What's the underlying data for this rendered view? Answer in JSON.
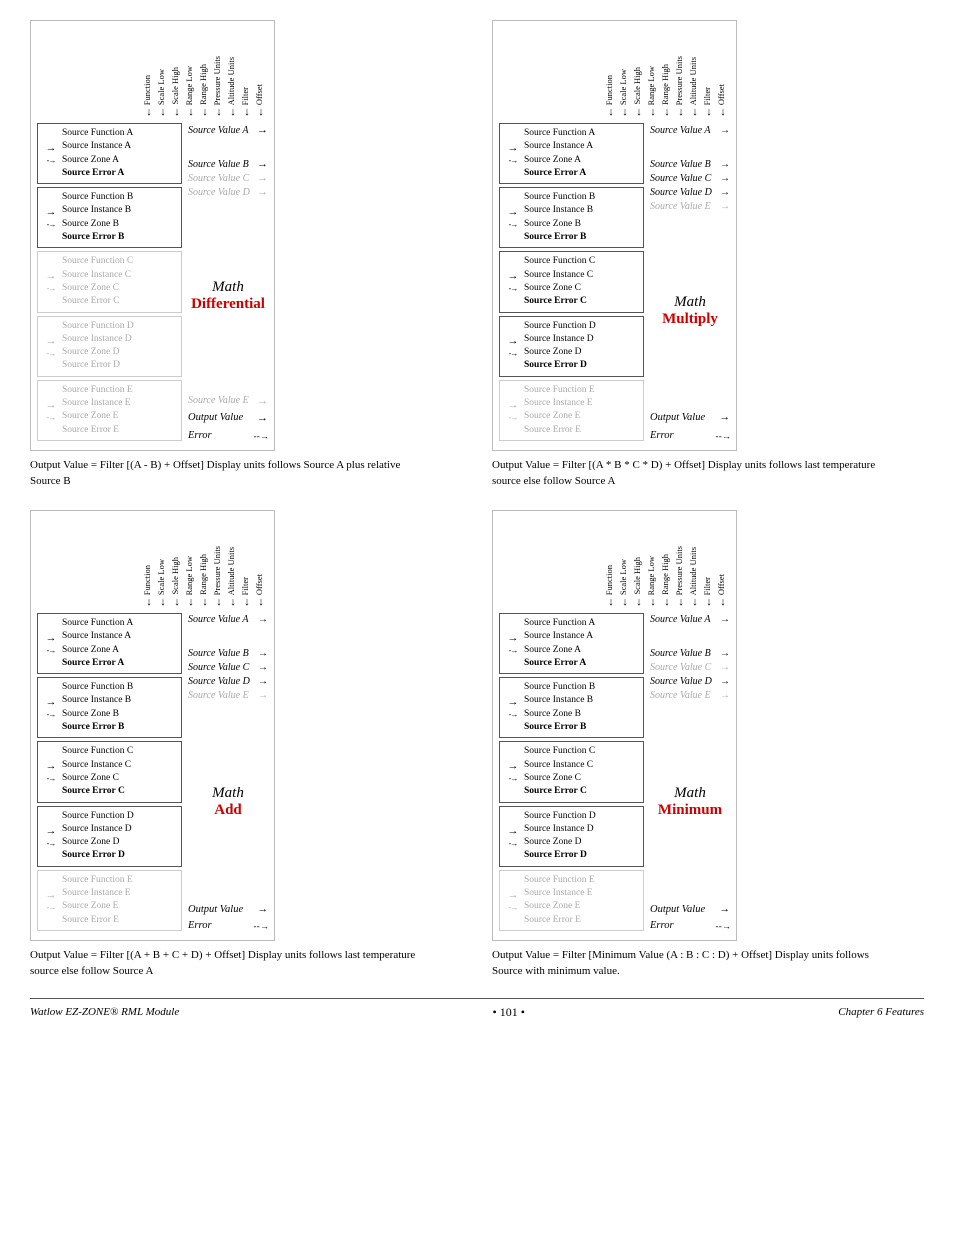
{
  "page": {
    "title": "Watlow EZ-ZONE® RML Module",
    "page_number": "101",
    "chapter": "Chapter 6 Features"
  },
  "col_headers": [
    "Function",
    "Scale Low",
    "Scale High",
    "Range Low",
    "Range High",
    "Pressure Units",
    "Altitude Units",
    "Filter",
    "Offset"
  ],
  "diagrams": [
    {
      "id": "diag1",
      "math_label": "Math",
      "math_type": "Differential",
      "math_color": "differential",
      "sources": [
        {
          "id": "A",
          "active": true,
          "function": "Source Function A",
          "instance": "Source Instance A",
          "zone": "Source Zone A",
          "error": "Source Error A",
          "has_solid_arrow": true,
          "has_dashed_arrow": true
        },
        {
          "id": "B",
          "active": true,
          "function": "Source Function B",
          "instance": "Source Instance B",
          "zone": "Source Zone B",
          "error": "Source Error B",
          "has_solid_arrow": true,
          "has_dashed_arrow": true
        },
        {
          "id": "C",
          "active": false,
          "function": "Source Function C",
          "instance": "Source Instance C",
          "zone": "Source Zone C",
          "error": "Source Error C",
          "has_solid_arrow": true,
          "has_dashed_arrow": true
        },
        {
          "id": "D",
          "active": false,
          "function": "Source Function D",
          "instance": "Source Instance D",
          "zone": "Source Zone D",
          "error": "Source Error D",
          "has_solid_arrow": true,
          "has_dashed_arrow": true
        },
        {
          "id": "E",
          "active": false,
          "function": "Source Function E",
          "instance": "Source Instance E",
          "zone": "Source Zone E",
          "error": "Source Error E",
          "has_solid_arrow": true,
          "has_dashed_arrow": true
        }
      ],
      "values": [
        {
          "label": "Source Value A",
          "active": true
        },
        {
          "label": "Source Value B",
          "active": true
        },
        {
          "label": "Source Value C",
          "active": false
        },
        {
          "label": "Source Value D",
          "active": false
        },
        {
          "label": "Source Value E",
          "active": false
        }
      ],
      "output_value": "Output Value",
      "output_error": "Error",
      "caption": "Output Value = Filter [(A - B) + Offset] Display units follows Source A plus relative Source B"
    },
    {
      "id": "diag2",
      "math_label": "Math",
      "math_type": "Multiply",
      "math_color": "multiply",
      "sources": [
        {
          "id": "A",
          "active": true,
          "function": "Source Function A",
          "instance": "Source Instance A",
          "zone": "Source Zone A",
          "error": "Source Error A"
        },
        {
          "id": "B",
          "active": true,
          "function": "Source Function B",
          "instance": "Source Instance B",
          "zone": "Source Zone B",
          "error": "Source Error B"
        },
        {
          "id": "C",
          "active": true,
          "function": "Source Function C",
          "instance": "Source Instance C",
          "zone": "Source Zone C",
          "error": "Source Error C"
        },
        {
          "id": "D",
          "active": true,
          "function": "Source Function D",
          "instance": "Source Instance D",
          "zone": "Source Zone D",
          "error": "Source Error D"
        },
        {
          "id": "E",
          "active": false,
          "function": "Source Function E",
          "instance": "Source Instance E",
          "zone": "Source Zone E",
          "error": "Source Error E"
        }
      ],
      "values": [
        {
          "label": "Source Value A",
          "active": true
        },
        {
          "label": "Source Value B",
          "active": true
        },
        {
          "label": "Source Value C",
          "active": true
        },
        {
          "label": "Source Value D",
          "active": true
        },
        {
          "label": "Source Value E",
          "active": false
        }
      ],
      "output_value": "Output Value",
      "output_error": "Error",
      "caption": "Output Value = Filter [(A * B * C * D) + Offset] Display units follows last temperature source else follow Source A"
    },
    {
      "id": "diag3",
      "math_label": "Math",
      "math_type": "Add",
      "math_color": "add",
      "sources": [
        {
          "id": "A",
          "active": true,
          "function": "Source Function A",
          "instance": "Source Instance A",
          "zone": "Source Zone A",
          "error": "Source Error A"
        },
        {
          "id": "B",
          "active": true,
          "function": "Source Function B",
          "instance": "Source Instance B",
          "zone": "Source Zone B",
          "error": "Source Error B"
        },
        {
          "id": "C",
          "active": true,
          "function": "Source Function C",
          "instance": "Source Instance C",
          "zone": "Source Zone C",
          "error": "Source Error C"
        },
        {
          "id": "D",
          "active": true,
          "function": "Source Function D",
          "instance": "Source Instance D",
          "zone": "Source Zone D",
          "error": "Source Error D"
        },
        {
          "id": "E",
          "active": false,
          "function": "Source Function E",
          "instance": "Source Instance E",
          "zone": "Source Zone E",
          "error": "Source Error E"
        }
      ],
      "values": [
        {
          "label": "Source Value A",
          "active": true
        },
        {
          "label": "Source Value B",
          "active": true
        },
        {
          "label": "Source Value C",
          "active": true
        },
        {
          "label": "Source Value D",
          "active": true
        },
        {
          "label": "Source Value E",
          "active": false
        }
      ],
      "output_value": "Output Value",
      "output_error": "Error",
      "caption": "Output Value = Filter [(A + B + C + D) + Offset] Display units follows last temperature source else follow Source A"
    },
    {
      "id": "diag4",
      "math_label": "Math",
      "math_type": "Minimum",
      "math_color": "minimum",
      "sources": [
        {
          "id": "A",
          "active": true,
          "function": "Source Function A",
          "instance": "Source Instance A",
          "zone": "Source Zone A",
          "error": "Source Error A"
        },
        {
          "id": "B",
          "active": true,
          "function": "Source Function B",
          "instance": "Source Instance B",
          "zone": "Source Zone B",
          "error": "Source Error B"
        },
        {
          "id": "C",
          "active": true,
          "function": "Source Function C",
          "instance": "Source Instance C",
          "zone": "Source Zone C",
          "error": "Source Error C"
        },
        {
          "id": "D",
          "active": true,
          "function": "Source Function D",
          "instance": "Source Instance D",
          "zone": "Source Zone D",
          "error": "Source Error D"
        },
        {
          "id": "E",
          "active": false,
          "function": "Source Function E",
          "instance": "Source Instance E",
          "zone": "Source Zone E",
          "error": "Source Error E"
        }
      ],
      "values": [
        {
          "label": "Source Value A",
          "active": true
        },
        {
          "label": "Source Value B",
          "active": true
        },
        {
          "label": "Source Value C",
          "active": true
        },
        {
          "label": "Source Value D",
          "active": true
        },
        {
          "label": "Source Value E",
          "active": false
        }
      ],
      "output_value": "Output Value",
      "output_error": "Error",
      "caption": "Output Value = Filter [Minimum Value (A : B : C : D) + Offset] Display units follows Source with minimum value."
    }
  ],
  "footer": {
    "left": "Watlow EZ-ZONE® RML Module",
    "center": "• 101 •",
    "right": "Chapter 6 Features"
  }
}
